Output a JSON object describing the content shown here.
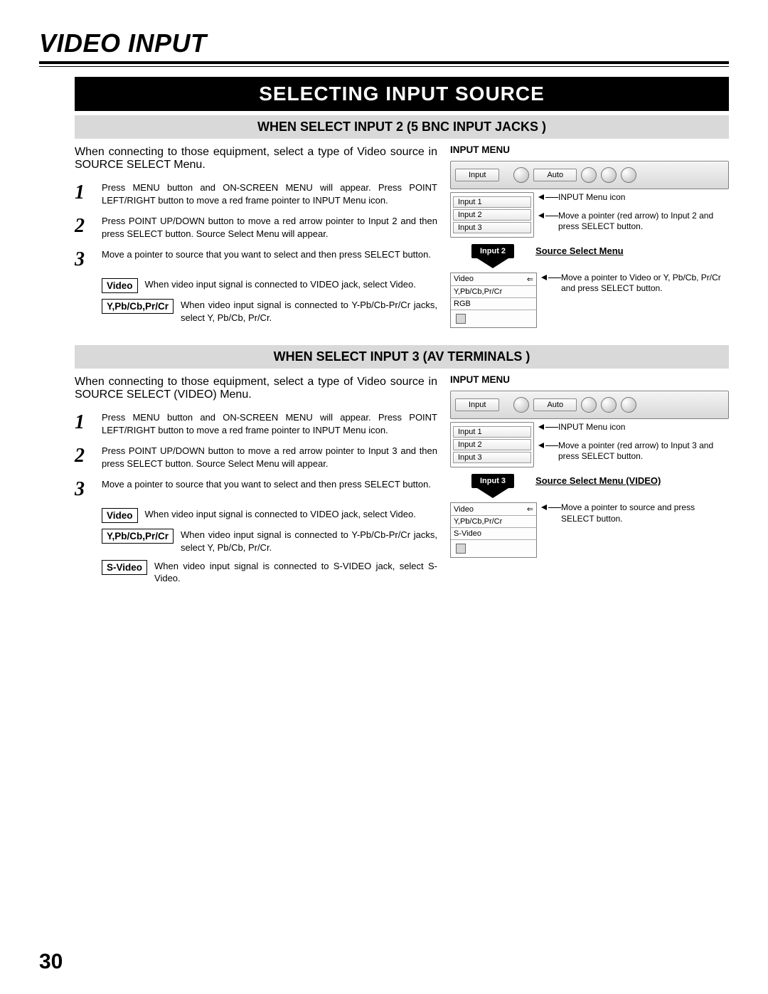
{
  "chapter_title": "VIDEO INPUT",
  "banner": "SELECTING INPUT SOURCE",
  "page_number": "30",
  "sec1": {
    "subhead": "WHEN SELECT INPUT 2 (5 BNC INPUT JACKS )",
    "intro": "When connecting to those equipment, select a type of Video source in SOURCE SELECT Menu.",
    "steps": [
      "Press MENU button and ON-SCREEN MENU will appear. Press POINT LEFT/RIGHT button to move a red frame pointer to INPUT Menu icon.",
      "Press POINT UP/DOWN button to move a red arrow pointer to Input 2 and then press SELECT button. Source Select Menu will appear.",
      "Move a pointer to source that you want to select and then press SELECT button."
    ],
    "options": [
      {
        "label": "Video",
        "text": "When video input signal is connected to VIDEO jack, select Video."
      },
      {
        "label": "Y,Pb/Cb,Pr/Cr",
        "text": "When video input signal is connected to Y-Pb/Cb-Pr/Cr jacks, select Y, Pb/Cb, Pr/Cr."
      }
    ],
    "menu": {
      "heading": "INPUT MENU",
      "bar_label": "Input",
      "bar_auto": "Auto",
      "list": [
        "Input 1",
        "Input 2",
        "Input 3"
      ],
      "annot_icon": "INPUT Menu icon",
      "annot_move": "Move a pointer (red arrow) to Input 2 and press SELECT button.",
      "arrow_label": "Input 2",
      "src_heading": "Source Select Menu",
      "src_items": [
        "Video",
        "Y,Pb/Cb,Pr/Cr",
        "RGB"
      ],
      "src_annot": "Move a pointer to Video or Y, Pb/Cb, Pr/Cr and press SELECT button."
    }
  },
  "sec2": {
    "subhead": "WHEN SELECT INPUT 3 (AV TERMINALS )",
    "intro": "When connecting to those equipment, select a type of Video source in SOURCE SELECT (VIDEO) Menu.",
    "steps": [
      "Press MENU button and ON-SCREEN MENU will appear. Press POINT LEFT/RIGHT button to move a red frame pointer to INPUT Menu icon.",
      "Press POINT UP/DOWN button to move a red arrow pointer to Input 3 and then press SELECT button. Source Select Menu will appear.",
      "Move a pointer to source that you want to select and then press SELECT button."
    ],
    "options": [
      {
        "label": "Video",
        "text": "When video input signal is connected to VIDEO jack, select Video."
      },
      {
        "label": "Y,Pb/Cb,Pr/Cr",
        "text": "When video input signal is connected to Y-Pb/Cb-Pr/Cr jacks, select Y, Pb/Cb, Pr/Cr."
      },
      {
        "label": "S-Video",
        "text": "When video input signal is connected to S-VIDEO jack, select S-Video."
      }
    ],
    "menu": {
      "heading": "INPUT MENU",
      "bar_label": "Input",
      "bar_auto": "Auto",
      "list": [
        "Input 1",
        "Input 2",
        "Input 3"
      ],
      "annot_icon": "INPUT Menu icon",
      "annot_move": "Move a pointer (red arrow) to Input 3 and press SELECT button.",
      "arrow_label": "Input 3",
      "src_heading": "Source Select Menu (VIDEO)",
      "src_items": [
        "Video",
        "Y,Pb/Cb,Pr/Cr",
        "S-Video"
      ],
      "src_annot": "Move a pointer to source and press SELECT button."
    }
  }
}
